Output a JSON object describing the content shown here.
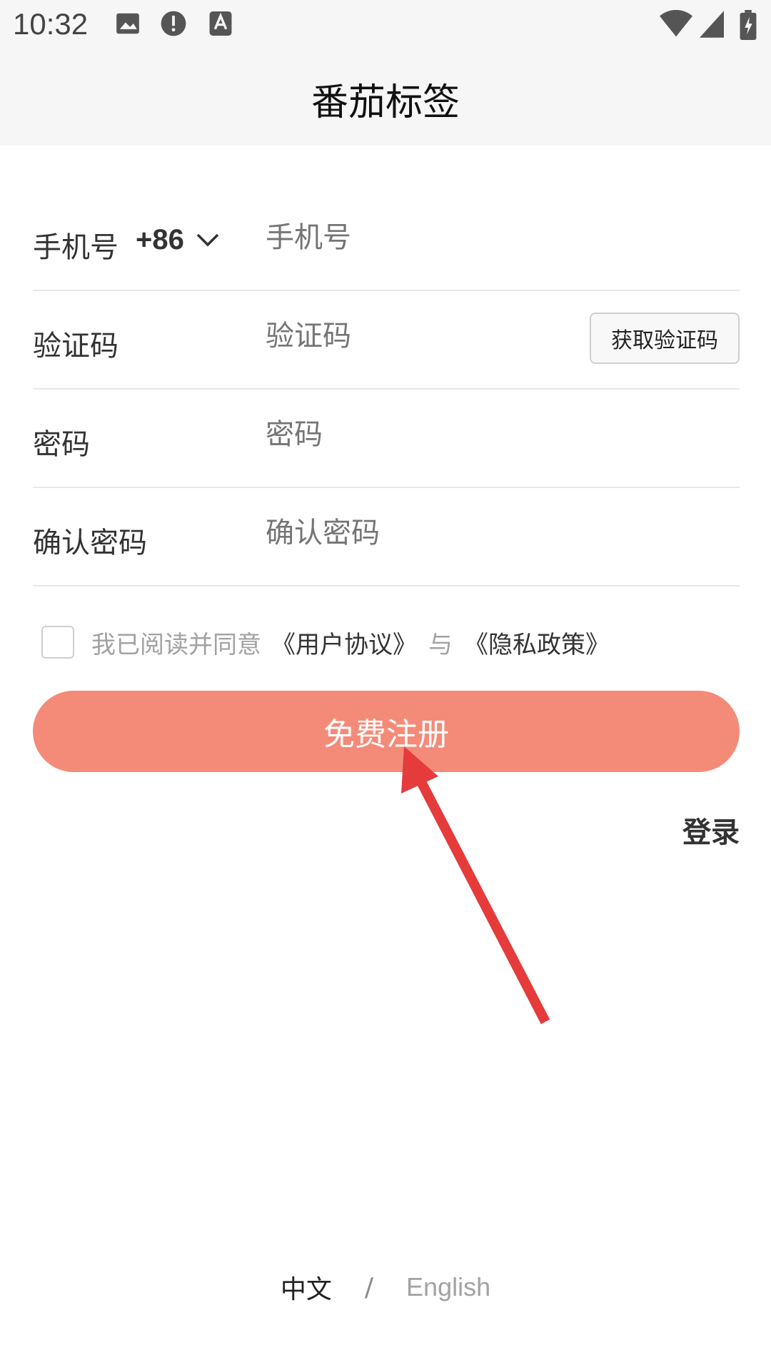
{
  "status_bar": {
    "time": "10:32",
    "icons": [
      "image-icon",
      "alert-icon",
      "text-a-icon",
      "wifi-icon",
      "signal-icon",
      "battery-icon"
    ]
  },
  "header": {
    "title": "番茄标签"
  },
  "form": {
    "phone": {
      "label": "手机号",
      "country_code": "+86",
      "placeholder": "手机号"
    },
    "code": {
      "label": "验证码",
      "placeholder": "验证码",
      "get_code_button": "获取验证码"
    },
    "password": {
      "label": "密码",
      "placeholder": "密码"
    },
    "confirm_password": {
      "label": "确认密码",
      "placeholder": "确认密码"
    }
  },
  "agreement": {
    "prefix": "我已阅读并同意",
    "user_agreement": "《用户协议》",
    "and": "与",
    "privacy_policy": "《隐私政策》"
  },
  "register_button": "免费注册",
  "login_link": "登录",
  "language": {
    "zh": "中文",
    "separator": "/",
    "en": "English"
  },
  "colors": {
    "accent": "#f48b79",
    "annotation_arrow": "#e53b3b"
  }
}
